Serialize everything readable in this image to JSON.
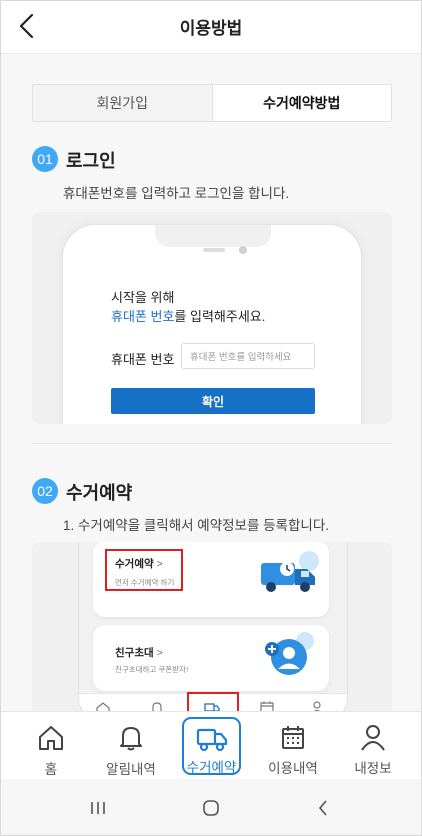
{
  "header": {
    "title": "이용방법"
  },
  "segment": {
    "tabs": [
      {
        "label": "회원가입",
        "active": false
      },
      {
        "label": "수거예약방법",
        "active": true
      }
    ]
  },
  "steps": [
    {
      "number": "01",
      "title": "로그인",
      "description": "휴대폰번호를 입력하고 로그인을 합니다.",
      "mockup": {
        "line1": "시작을 위해",
        "line2_highlight": "휴대폰 번호",
        "line2_rest": "를 입력해주세요.",
        "field_label": "휴대폰 번호",
        "field_placeholder": "휴대폰 번호를 입력하세요",
        "button_label": "확인"
      }
    },
    {
      "number": "02",
      "title": "수거예약",
      "description": "1. 수거예약을 클릭해서 예약정보를 등록합니다.",
      "mockup": {
        "card1_title": "수거예약",
        "card1_chevron": ">",
        "card1_sub": "먼저 수거예약 하기",
        "card2_title": "친구초대",
        "card2_chevron": ">",
        "card2_sub": "친구초대하고 쿠폰받자!"
      }
    }
  ],
  "tabbar": {
    "items": [
      {
        "label": "홈",
        "icon": "home-icon",
        "active": false
      },
      {
        "label": "알림내역",
        "icon": "bell-icon",
        "active": false
      },
      {
        "label": "수거예약",
        "icon": "truck-icon",
        "active": true
      },
      {
        "label": "이용내역",
        "icon": "calendar-icon",
        "active": false
      },
      {
        "label": "내정보",
        "icon": "person-icon",
        "active": false
      }
    ]
  },
  "colors": {
    "accent_blue": "#1f7dd9",
    "step_badge": "#3fa9f5",
    "highlight_red": "#e02020"
  }
}
